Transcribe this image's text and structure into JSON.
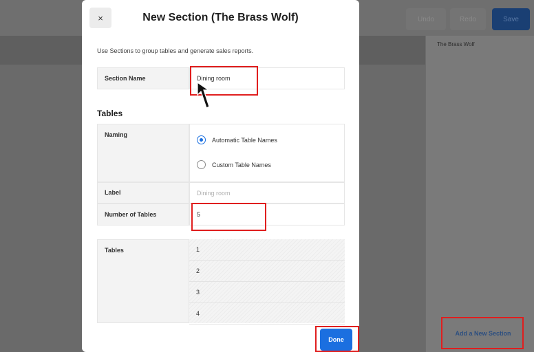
{
  "background": {
    "toolbar": {
      "undo_label": "Undo",
      "redo_label": "Redo",
      "save_label": "Save"
    },
    "panel_title": "The Brass Wolf",
    "add_section_label": "Add a New Section"
  },
  "modal": {
    "title": "New Section (The Brass Wolf)",
    "close_icon": "×",
    "description": "Use Sections to group tables and generate sales reports.",
    "section_name": {
      "label": "Section Name",
      "value": "Dining room"
    },
    "tables_heading": "Tables",
    "naming": {
      "label": "Naming",
      "options": [
        {
          "label": "Automatic Table Names",
          "selected": true
        },
        {
          "label": "Custom Table Names",
          "selected": false
        }
      ]
    },
    "label_field": {
      "label": "Label",
      "placeholder": "Dining room"
    },
    "number_of_tables": {
      "label": "Number of Tables",
      "value": "5"
    },
    "tables_list": {
      "label": "Tables",
      "items": [
        "1",
        "2",
        "3",
        "4"
      ]
    },
    "done_label": "Done"
  },
  "colors": {
    "accent": "#1b6fe0",
    "highlight": "#e01e1e"
  }
}
